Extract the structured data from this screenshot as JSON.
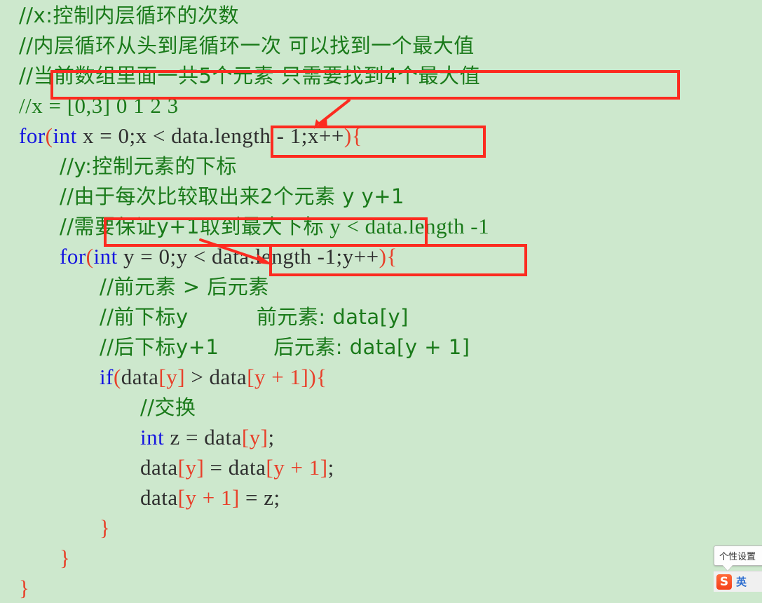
{
  "editor": {
    "background_color": "#cde8cd",
    "comment_color": "#1a7a1a",
    "keyword_color": "#1515e0",
    "bracket_color": "#e8402a",
    "plain_color": "#2f2f2f",
    "annotation_color": "#fc2b20",
    "lines": [
      {
        "indent": 0,
        "text": "//x:控制内层循环的次数"
      },
      {
        "indent": 0,
        "text": "//内层循环从头到尾循环一次 可以找到一个最大值"
      },
      {
        "indent": 0,
        "text": "//当前数组里面一共5个元素 只需要找到4个最大值"
      },
      {
        "indent": 0,
        "text": "//x = [0,3] 0 1 2 3"
      },
      {
        "indent": 0,
        "text": "for(int x = 0;x < data.length - 1;x++){"
      },
      {
        "indent": 1,
        "text": "//y:控制元素的下标"
      },
      {
        "indent": 1,
        "text": "//由于每次比较取出来2个元素 y y+1"
      },
      {
        "indent": 1,
        "text": "//需要保证y+1取到最大下标 y < data.length -1"
      },
      {
        "indent": 1,
        "text": "for(int y = 0;y < data.length -1;y++){"
      },
      {
        "indent": 2,
        "text": "//前元素 > 后元素"
      },
      {
        "indent": 2,
        "text": "//前下标y          前元素: data[y]"
      },
      {
        "indent": 2,
        "text": "//后下标y+1        后元素: data[y + 1]"
      },
      {
        "indent": 2,
        "text": "if(data[y] > data[y + 1]){"
      },
      {
        "indent": 3,
        "text": "//交换"
      },
      {
        "indent": 3,
        "text": "int z = data[y];"
      },
      {
        "indent": 3,
        "text": "data[y] = data[y + 1];"
      },
      {
        "indent": 3,
        "text": "data[y + 1] = z;"
      },
      {
        "indent": 2,
        "text": "}"
      },
      {
        "indent": 1,
        "text": "}"
      },
      {
        "indent": 0,
        "text": "}"
      }
    ],
    "tokens": {
      "l1_comment": "//x:控制内层循环的次数",
      "l2_comment": "//内层循环从头到尾循环一次 可以找到一个最大值",
      "l3_comment": "//当前数组里面一共5个元素 只需要找到4个最大值",
      "l4_comment": "//x = [0,3] 0 1 2 3",
      "l5_for": "for",
      "l5_open": "(",
      "l5_int": "int",
      "l5_mid": " x = 0;x < ",
      "l5_boxed": "data.length - 1",
      "l5_semi": ";x++",
      "l5_close": ")",
      "l5_brace": "{",
      "l6_comment": "//y:控制元素的下标",
      "l7_comment": "//由于每次比较取出来2个元素 y y+1",
      "l8_boxed": "//需要保证y+1取到最大下标",
      "l8_rest": " y < data.length -1",
      "l9_for": "for",
      "l9_open": "(",
      "l9_int": "int",
      "l9_mid": " y = 0;",
      "l9_boxed": "y < data.length -1",
      "l9_semi": ";y++",
      "l9_close": ")",
      "l9_brace": "{",
      "l10_comment": "//前元素 > 后元素",
      "l11_comment": "//前下标y          前元素: data[y]",
      "l12_comment": "//后下标y+1        后元素: data[y + 1]",
      "l13_if": "if",
      "l13_open": "(",
      "l13_d1": "data",
      "l13_b1": "[y]",
      "l13_gt": " > ",
      "l13_d2": "data",
      "l13_b2": "[y + 1]",
      "l13_close": ")",
      "l13_brace": "{",
      "l14_comment": "//交换",
      "l15_int": "int",
      "l15_mid": " z = data",
      "l15_b": "[y]",
      "l15_end": ";",
      "l16_d1": "data",
      "l16_b1": "[y]",
      "l16_eq": " = data",
      "l16_b2": "[y + 1]",
      "l16_end": ";",
      "l17_d1": "data",
      "l17_b1": "[y + 1]",
      "l17_eq": " = z;",
      "l18_brace": "}",
      "l19_brace": "}",
      "l20_brace": "}"
    }
  },
  "annotations": {
    "boxes": [
      {
        "name": "highlight-comment-array-elements",
        "label": "当前数组里面一共5个元素 只需要找到4个最大值"
      },
      {
        "name": "highlight-outer-loop-condition",
        "label": "data.length - 1"
      },
      {
        "name": "highlight-comment-max-index",
        "label": "需要保证y+1取到最大下标"
      },
      {
        "name": "highlight-inner-loop-condition",
        "label": "y < data.length -1"
      }
    ],
    "arrows": [
      {
        "name": "arrow-to-outer-condition",
        "direction": "down-left"
      },
      {
        "name": "arrow-to-inner-condition",
        "direction": "down-right"
      }
    ]
  },
  "ime": {
    "tooltip": "个性设置",
    "logo": "S",
    "mode": "英"
  }
}
